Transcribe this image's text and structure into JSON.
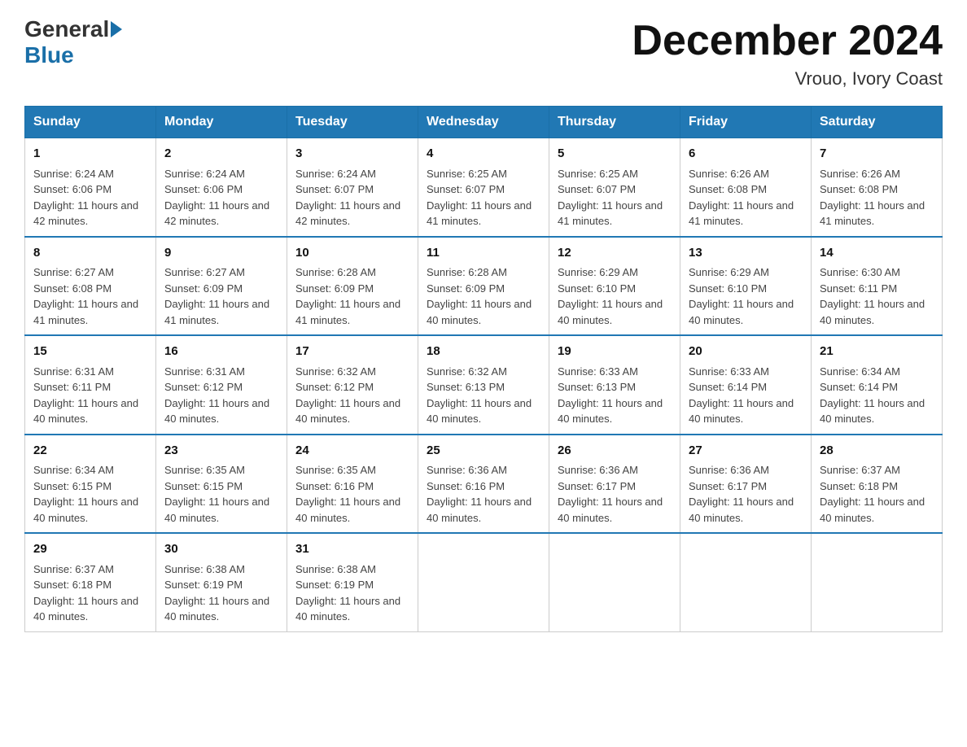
{
  "logo": {
    "text1": "General",
    "text2": "Blue"
  },
  "title": "December 2024",
  "location": "Vrouo, Ivory Coast",
  "days_of_week": [
    "Sunday",
    "Monday",
    "Tuesday",
    "Wednesday",
    "Thursday",
    "Friday",
    "Saturday"
  ],
  "weeks": [
    [
      {
        "day": "1",
        "sunrise": "6:24 AM",
        "sunset": "6:06 PM",
        "daylight": "11 hours and 42 minutes."
      },
      {
        "day": "2",
        "sunrise": "6:24 AM",
        "sunset": "6:06 PM",
        "daylight": "11 hours and 42 minutes."
      },
      {
        "day": "3",
        "sunrise": "6:24 AM",
        "sunset": "6:07 PM",
        "daylight": "11 hours and 42 minutes."
      },
      {
        "day": "4",
        "sunrise": "6:25 AM",
        "sunset": "6:07 PM",
        "daylight": "11 hours and 41 minutes."
      },
      {
        "day": "5",
        "sunrise": "6:25 AM",
        "sunset": "6:07 PM",
        "daylight": "11 hours and 41 minutes."
      },
      {
        "day": "6",
        "sunrise": "6:26 AM",
        "sunset": "6:08 PM",
        "daylight": "11 hours and 41 minutes."
      },
      {
        "day": "7",
        "sunrise": "6:26 AM",
        "sunset": "6:08 PM",
        "daylight": "11 hours and 41 minutes."
      }
    ],
    [
      {
        "day": "8",
        "sunrise": "6:27 AM",
        "sunset": "6:08 PM",
        "daylight": "11 hours and 41 minutes."
      },
      {
        "day": "9",
        "sunrise": "6:27 AM",
        "sunset": "6:09 PM",
        "daylight": "11 hours and 41 minutes."
      },
      {
        "day": "10",
        "sunrise": "6:28 AM",
        "sunset": "6:09 PM",
        "daylight": "11 hours and 41 minutes."
      },
      {
        "day": "11",
        "sunrise": "6:28 AM",
        "sunset": "6:09 PM",
        "daylight": "11 hours and 40 minutes."
      },
      {
        "day": "12",
        "sunrise": "6:29 AM",
        "sunset": "6:10 PM",
        "daylight": "11 hours and 40 minutes."
      },
      {
        "day": "13",
        "sunrise": "6:29 AM",
        "sunset": "6:10 PM",
        "daylight": "11 hours and 40 minutes."
      },
      {
        "day": "14",
        "sunrise": "6:30 AM",
        "sunset": "6:11 PM",
        "daylight": "11 hours and 40 minutes."
      }
    ],
    [
      {
        "day": "15",
        "sunrise": "6:31 AM",
        "sunset": "6:11 PM",
        "daylight": "11 hours and 40 minutes."
      },
      {
        "day": "16",
        "sunrise": "6:31 AM",
        "sunset": "6:12 PM",
        "daylight": "11 hours and 40 minutes."
      },
      {
        "day": "17",
        "sunrise": "6:32 AM",
        "sunset": "6:12 PM",
        "daylight": "11 hours and 40 minutes."
      },
      {
        "day": "18",
        "sunrise": "6:32 AM",
        "sunset": "6:13 PM",
        "daylight": "11 hours and 40 minutes."
      },
      {
        "day": "19",
        "sunrise": "6:33 AM",
        "sunset": "6:13 PM",
        "daylight": "11 hours and 40 minutes."
      },
      {
        "day": "20",
        "sunrise": "6:33 AM",
        "sunset": "6:14 PM",
        "daylight": "11 hours and 40 minutes."
      },
      {
        "day": "21",
        "sunrise": "6:34 AM",
        "sunset": "6:14 PM",
        "daylight": "11 hours and 40 minutes."
      }
    ],
    [
      {
        "day": "22",
        "sunrise": "6:34 AM",
        "sunset": "6:15 PM",
        "daylight": "11 hours and 40 minutes."
      },
      {
        "day": "23",
        "sunrise": "6:35 AM",
        "sunset": "6:15 PM",
        "daylight": "11 hours and 40 minutes."
      },
      {
        "day": "24",
        "sunrise": "6:35 AM",
        "sunset": "6:16 PM",
        "daylight": "11 hours and 40 minutes."
      },
      {
        "day": "25",
        "sunrise": "6:36 AM",
        "sunset": "6:16 PM",
        "daylight": "11 hours and 40 minutes."
      },
      {
        "day": "26",
        "sunrise": "6:36 AM",
        "sunset": "6:17 PM",
        "daylight": "11 hours and 40 minutes."
      },
      {
        "day": "27",
        "sunrise": "6:36 AM",
        "sunset": "6:17 PM",
        "daylight": "11 hours and 40 minutes."
      },
      {
        "day": "28",
        "sunrise": "6:37 AM",
        "sunset": "6:18 PM",
        "daylight": "11 hours and 40 minutes."
      }
    ],
    [
      {
        "day": "29",
        "sunrise": "6:37 AM",
        "sunset": "6:18 PM",
        "daylight": "11 hours and 40 minutes."
      },
      {
        "day": "30",
        "sunrise": "6:38 AM",
        "sunset": "6:19 PM",
        "daylight": "11 hours and 40 minutes."
      },
      {
        "day": "31",
        "sunrise": "6:38 AM",
        "sunset": "6:19 PM",
        "daylight": "11 hours and 40 minutes."
      },
      null,
      null,
      null,
      null
    ]
  ]
}
